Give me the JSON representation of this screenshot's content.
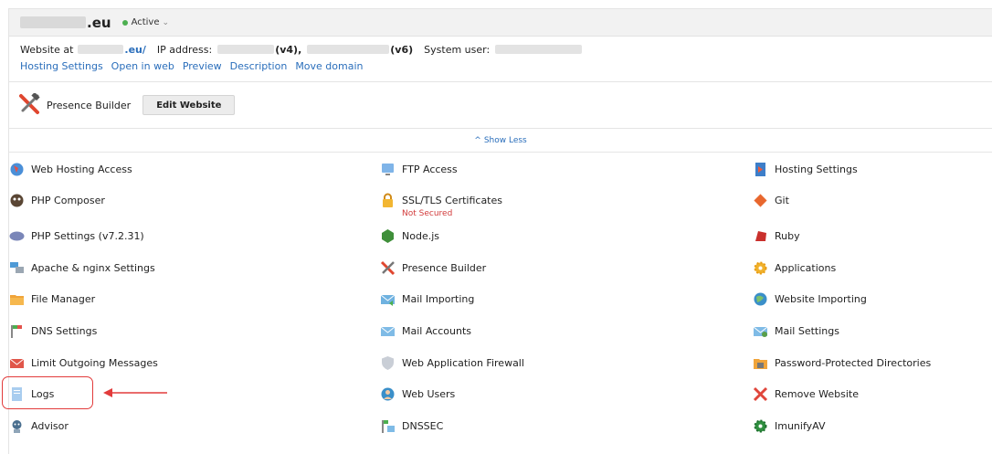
{
  "header": {
    "domain_suffix": ".eu",
    "status_label": "Active",
    "status_caret": "⌄"
  },
  "info": {
    "website_at_label": "Website at",
    "website_suffix": ".eu/",
    "ip_label": "IP address:",
    "ipv4_suffix": "(v4),",
    "ipv6_suffix": "(v6)",
    "system_user_label": "System user:",
    "links": [
      {
        "label": "Hosting Settings"
      },
      {
        "label": "Open in web"
      },
      {
        "label": "Preview"
      },
      {
        "label": "Description"
      },
      {
        "label": "Move domain"
      }
    ]
  },
  "builder": {
    "label": "Presence Builder",
    "button": "Edit Website"
  },
  "show_less": {
    "chevron": "^",
    "label": "Show Less"
  },
  "tools": [
    [
      {
        "label": "Web Hosting Access",
        "icon": "web-hosting-access-icon"
      },
      {
        "label": "FTP Access",
        "icon": "ftp-access-icon"
      },
      {
        "label": "Hosting Settings",
        "icon": "hosting-settings-icon"
      }
    ],
    [
      {
        "label": "PHP Composer",
        "icon": "php-composer-icon"
      },
      {
        "label": "SSL/TLS Certificates",
        "icon": "lock-icon",
        "sub": "Not Secured"
      },
      {
        "label": "Git",
        "icon": "git-icon"
      }
    ],
    [
      {
        "label": "PHP Settings (v7.2.31)",
        "icon": "php-icon"
      },
      {
        "label": "Node.js",
        "icon": "nodejs-icon"
      },
      {
        "label": "Ruby",
        "icon": "ruby-icon"
      }
    ],
    [
      {
        "label": "Apache & nginx Settings",
        "icon": "apache-nginx-icon"
      },
      {
        "label": "Presence Builder",
        "icon": "presence-builder-icon"
      },
      {
        "label": "Applications",
        "icon": "applications-gear-icon"
      }
    ],
    [
      {
        "label": "File Manager",
        "icon": "folder-icon"
      },
      {
        "label": "Mail Importing",
        "icon": "mail-importing-icon"
      },
      {
        "label": "Website Importing",
        "icon": "website-importing-icon"
      }
    ],
    [
      {
        "label": "DNS Settings",
        "icon": "dns-settings-icon"
      },
      {
        "label": "Mail Accounts",
        "icon": "mail-accounts-icon"
      },
      {
        "label": "Mail Settings",
        "icon": "mail-settings-icon"
      }
    ],
    [
      {
        "label": "Limit Outgoing Messages",
        "icon": "limit-outgoing-icon"
      },
      {
        "label": "Web Application Firewall",
        "icon": "shield-icon"
      },
      {
        "label": "Password-Protected Directories",
        "icon": "protected-folder-icon"
      }
    ],
    [
      {
        "label": "Logs",
        "icon": "logs-icon"
      },
      {
        "label": "Web Users",
        "icon": "web-users-icon"
      },
      {
        "label": "Remove Website",
        "icon": "remove-x-icon"
      }
    ],
    [
      {
        "label": "Advisor",
        "icon": "advisor-icon"
      },
      {
        "label": "DNSSEC",
        "icon": "dnssec-icon"
      },
      {
        "label": "ImunifyAV",
        "icon": "imunifyav-icon"
      }
    ]
  ],
  "colors": {
    "link": "#2a6ebb",
    "status_active": "#4caf50",
    "warning": "#d23b3b",
    "annotation": "#e23b3b"
  }
}
